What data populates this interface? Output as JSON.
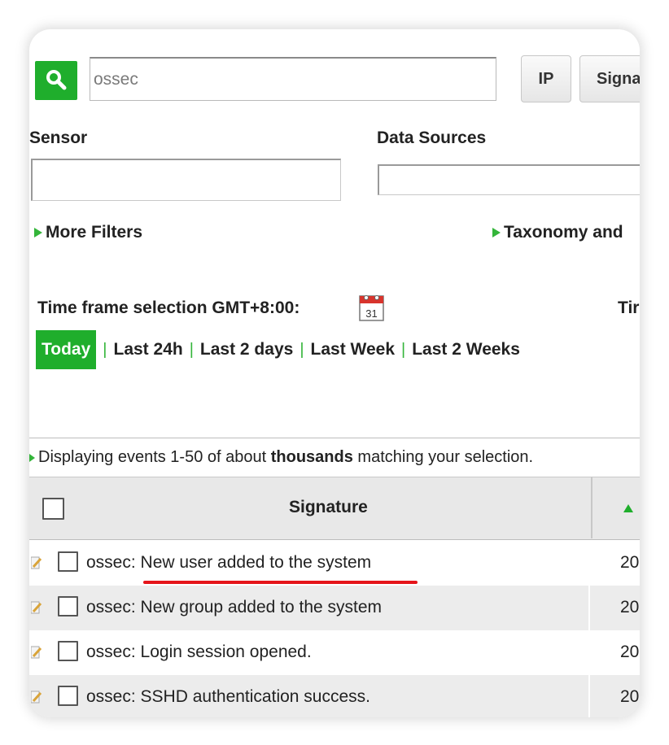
{
  "search": {
    "value": "ossec",
    "buttons": [
      "IP",
      "Signa"
    ]
  },
  "filters": {
    "sensor_label": "Sensor",
    "data_sources_label": "Data Sources",
    "more_filters": "More Filters",
    "taxonomy": "Taxonomy and"
  },
  "timeframe": {
    "label": "Time frame selection GMT+8:00:",
    "right_label": "Tir",
    "calendar_day": "31",
    "options": [
      "Today",
      "Last 24h",
      "Last 2 days",
      "Last Week",
      "Last 2 Weeks"
    ],
    "selected": "Today",
    "separator": "|"
  },
  "summary": {
    "prefix": "Displaying events 1-50 of about ",
    "bold": "thousands",
    "suffix": " matching your selection."
  },
  "table": {
    "header_signature": "Signature",
    "sort_icon": "triangle-up-icon",
    "rows": [
      {
        "signature": "ossec: New user added to the system",
        "date": "20"
      },
      {
        "signature": "ossec: New group added to the system",
        "date": "20"
      },
      {
        "signature": "ossec: Login session opened.",
        "date": "20"
      },
      {
        "signature": "ossec: SSHD authentication success.",
        "date": "20"
      }
    ]
  },
  "colors": {
    "accent_green": "#1fae2c",
    "annotation_red": "#e5141a"
  }
}
